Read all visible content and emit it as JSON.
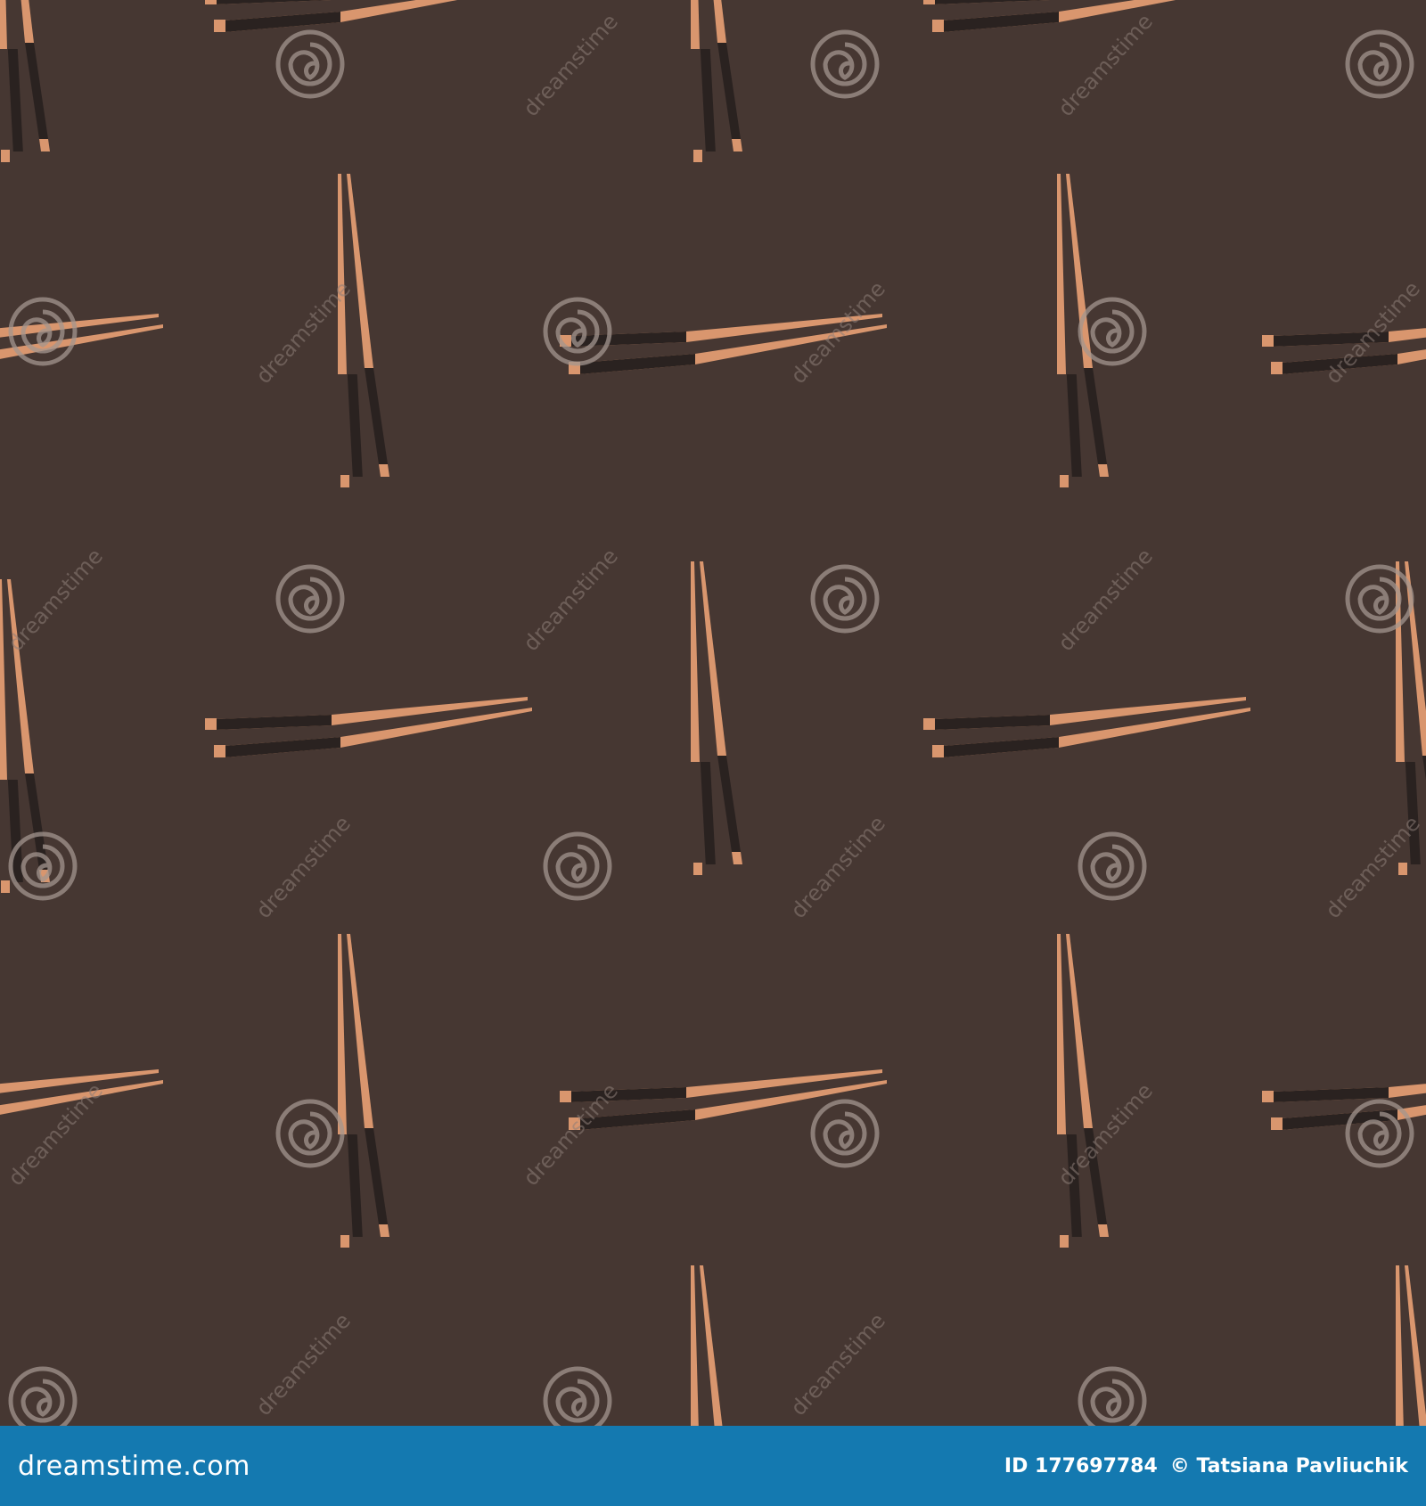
{
  "watermark": {
    "text": "dreamstime",
    "logo": "dreamstime-spiral-icon"
  },
  "footer": {
    "brand": "dreamstime.com",
    "image_id": "ID 177697784",
    "copyright_symbol": "©",
    "author": "Tatsiana Pavliuchik"
  },
  "colors": {
    "background": "#463732",
    "chopstick_light": "#d9966e",
    "chopstick_dark": "#2a2220",
    "footer_bar": "#1479b0"
  }
}
